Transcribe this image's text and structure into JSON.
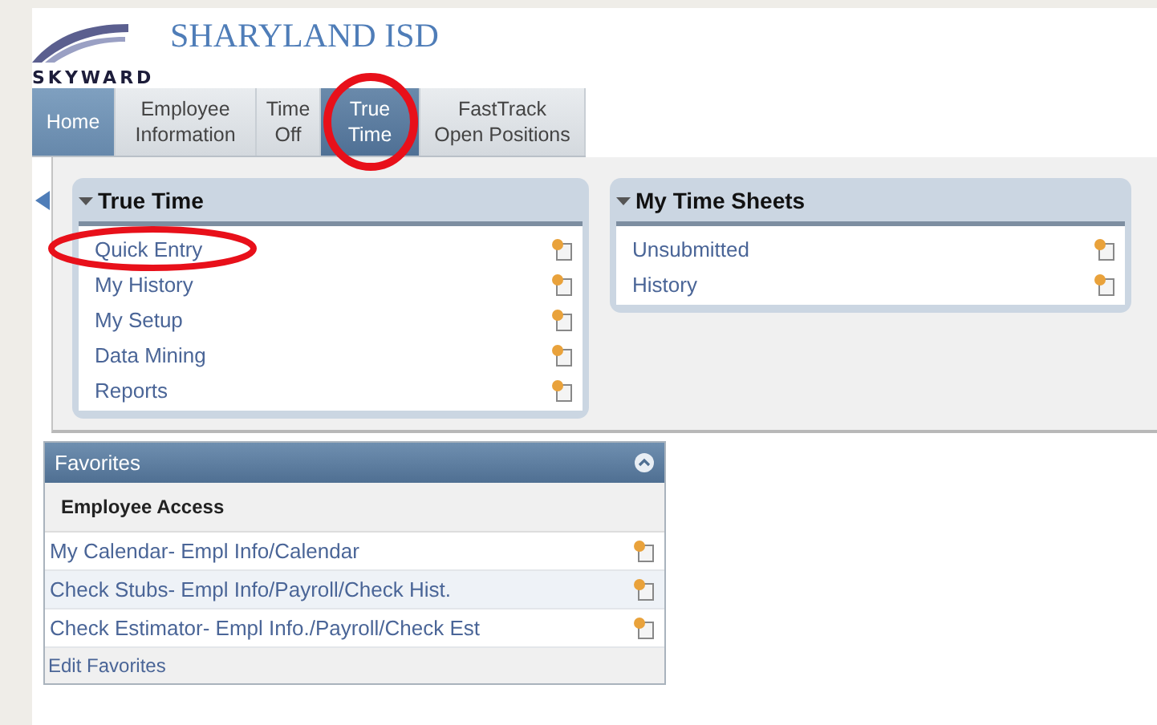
{
  "header": {
    "logo_text": "SKYWARD",
    "district": "SHARYLAND ISD"
  },
  "tabs": [
    {
      "kind": "home",
      "lines": [
        "Home"
      ],
      "selected": false
    },
    {
      "kind": "menu",
      "lines": [
        "Employee",
        "Information"
      ],
      "selected": false
    },
    {
      "kind": "menu",
      "lines": [
        "Time",
        "Off"
      ],
      "selected": false
    },
    {
      "kind": "menu",
      "lines": [
        "True",
        "Time"
      ],
      "selected": true
    },
    {
      "kind": "menu",
      "lines": [
        "FastTrack",
        "Open Positions"
      ],
      "selected": false
    }
  ],
  "panels": [
    {
      "title": "True Time",
      "expanded": true,
      "items": [
        "Quick Entry",
        "My History",
        "My Setup",
        "Data Mining",
        "Reports"
      ]
    },
    {
      "title": "My Time Sheets",
      "expanded": true,
      "items": [
        "Unsubmitted",
        "History"
      ]
    }
  ],
  "favorites": {
    "title": "Favorites",
    "group": "Employee Access",
    "items": [
      "My Calendar- Empl Info/Calendar",
      "Check Stubs- Empl Info/Payroll/Check Hist.",
      "Check Estimator- Empl Info./Payroll/Check Est"
    ],
    "edit_link": "Edit Favorites"
  }
}
